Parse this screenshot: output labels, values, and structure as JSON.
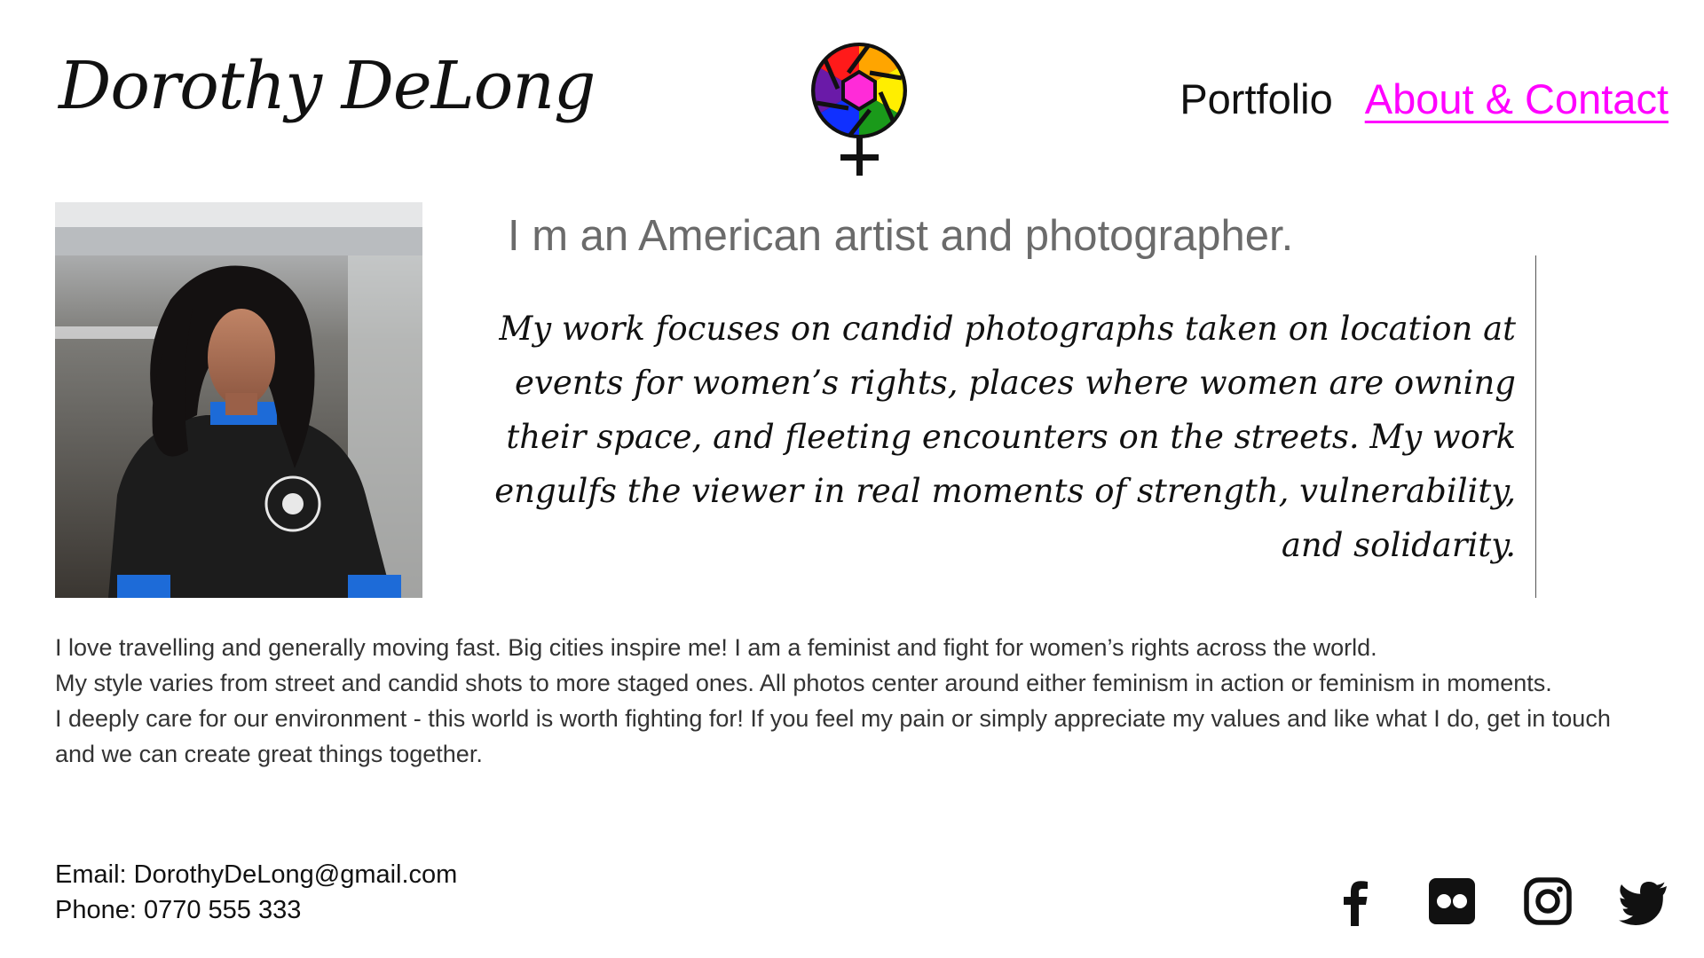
{
  "header": {
    "site_name": "Dorothy DeLong",
    "logo_icon": "camera-aperture-female-symbol-icon"
  },
  "nav": {
    "items": [
      {
        "label": "Portfolio",
        "active": false
      },
      {
        "label": "About & Contact",
        "active": true
      }
    ],
    "active_color": "#ff00ff"
  },
  "intro": {
    "headline": "I m an American artist and photographer.",
    "quote": "My work focuses on candid photographs taken on location at events for women’s rights, places where women are owning their space, and fleeting encounters on the streets. My work engulfs the viewer in real moments of strength, vulnerability, and solidarity."
  },
  "bio": {
    "lines": [
      "I love travelling and generally moving fast. Big cities inspire me! I am a feminist and fight for women’s rights across the world.",
      "My style varies from street and candid shots to more staged ones. All photos center around either feminism in action or feminism in moments.",
      "I deeply care for our environment - this world is worth fighting for! If you feel my pain or simply appreciate my values and like what I do, get in touch and we can create great things together."
    ]
  },
  "contact": {
    "email": "Email: DorothyDeLong@gmail.com",
    "phone": "Phone: 0770 555 333"
  },
  "social": [
    {
      "icon": "facebook-icon"
    },
    {
      "icon": "flickr-icon"
    },
    {
      "icon": "instagram-icon"
    },
    {
      "icon": "twitter-icon"
    }
  ]
}
